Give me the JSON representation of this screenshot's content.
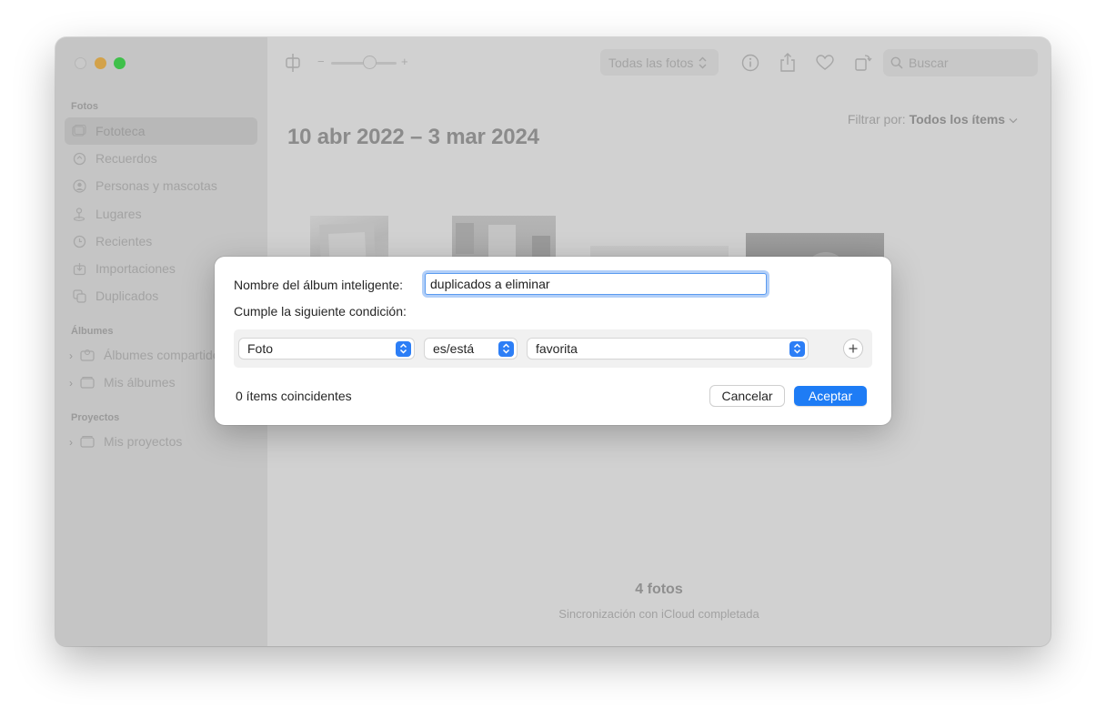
{
  "sidebar": {
    "sections": {
      "fotos": "Fotos",
      "albumes": "Álbumes",
      "proyectos": "Proyectos"
    },
    "items": [
      {
        "label": "Fototeca",
        "icon": "photo-library-icon"
      },
      {
        "label": "Recuerdos",
        "icon": "memories-icon"
      },
      {
        "label": "Personas y mascotas",
        "icon": "people-icon"
      },
      {
        "label": "Lugares",
        "icon": "places-icon"
      },
      {
        "label": "Recientes",
        "icon": "clock-icon"
      },
      {
        "label": "Importaciones",
        "icon": "import-icon"
      },
      {
        "label": "Duplicados",
        "icon": "duplicates-icon"
      }
    ],
    "albums": [
      {
        "label": "Álbumes compartidos",
        "icon": "shared-album-icon"
      },
      {
        "label": "Mis álbumes",
        "icon": "folder-icon"
      }
    ],
    "projects": [
      {
        "label": "Mis proyectos",
        "icon": "folder-icon"
      }
    ]
  },
  "toolbar": {
    "slider_minus": "−",
    "slider_plus": "+",
    "view_select": "Todas las fotos",
    "search_placeholder": "Buscar"
  },
  "main": {
    "filter_label": "Filtrar por:",
    "filter_value": "Todos los ítems",
    "date_range": "10 abr 2022 – 3 mar 2024",
    "photo_count": "4 fotos",
    "sync_status": "Sincronización con iCloud completada"
  },
  "dialog": {
    "name_label": "Nombre del álbum inteligente:",
    "name_value": "duplicados a eliminar",
    "condition_label": "Cumple la siguiente condición:",
    "rule": {
      "field": "Foto",
      "operator": "es/está",
      "value": "favorita"
    },
    "matching": "0 ítems coincidentes",
    "cancel": "Cancelar",
    "accept": "Aceptar"
  },
  "colors": {
    "accent": "#1e7cf5",
    "close": "#c9c9c9",
    "minimize": "#d3a24a",
    "maximize": "#3fc04a"
  }
}
